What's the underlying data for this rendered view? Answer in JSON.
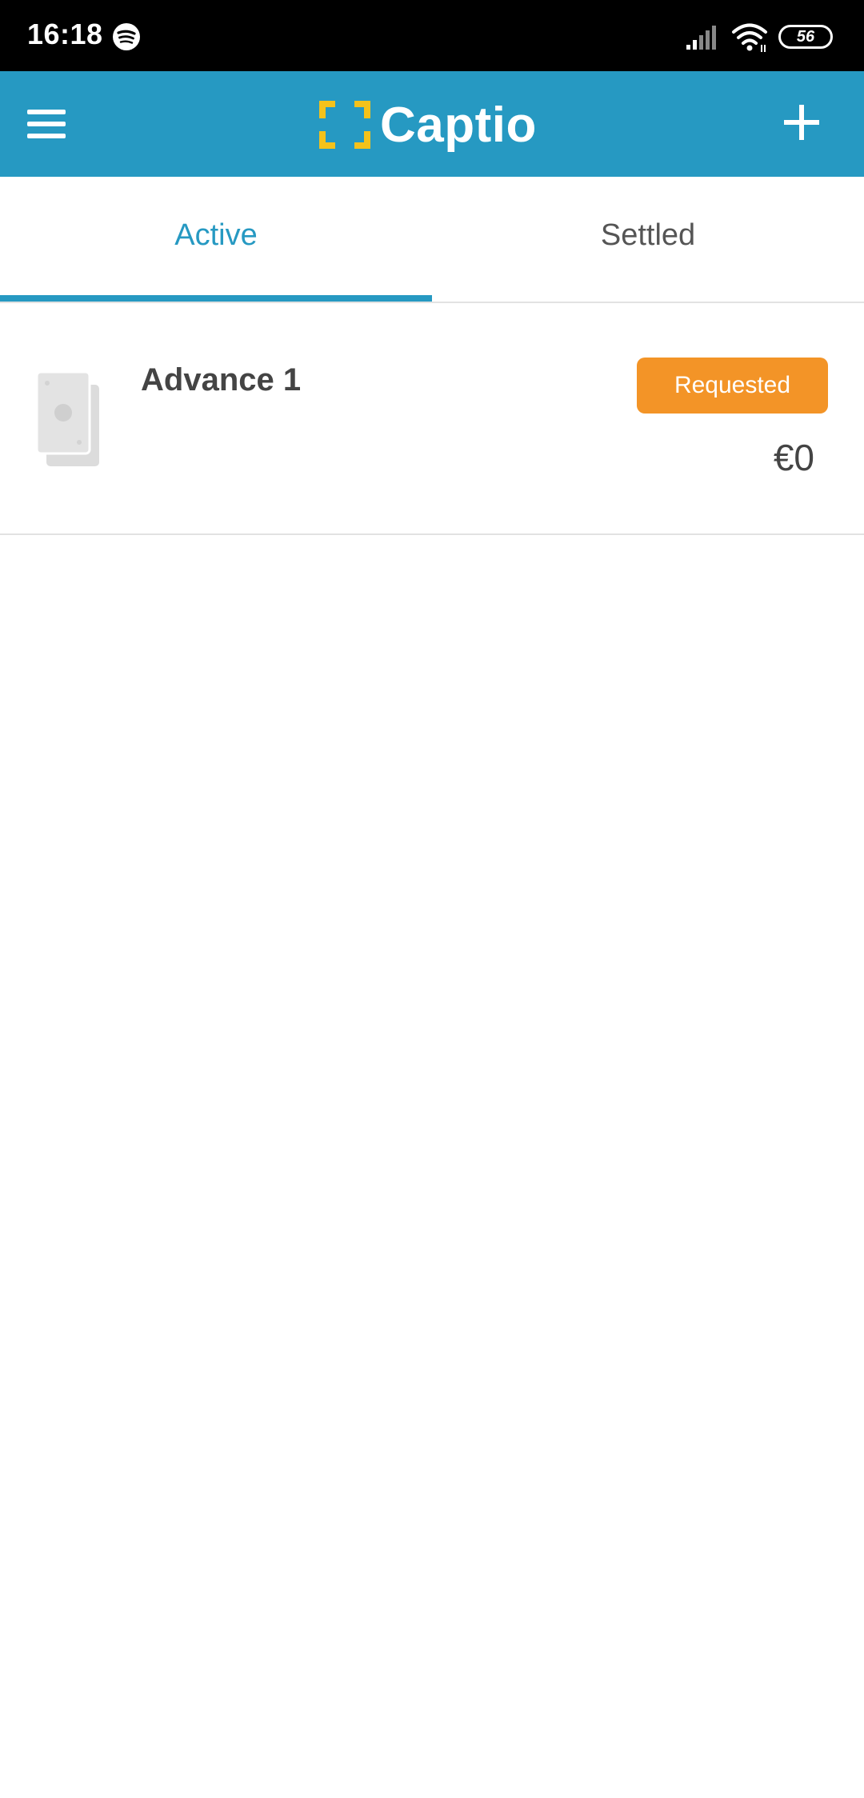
{
  "status_bar": {
    "time": "16:18",
    "battery": "56",
    "icons": [
      "spotify-icon",
      "signal-icon",
      "wifi-icon",
      "battery-icon"
    ]
  },
  "header": {
    "app_name": "Captio",
    "menu_icon": "hamburger-menu-icon",
    "add_icon": "plus-icon",
    "background_color": "#2699c2",
    "logo_color": "#f4c21b"
  },
  "tabs": [
    {
      "label": "Active",
      "selected": true
    },
    {
      "label": "Settled",
      "selected": false
    }
  ],
  "advances": [
    {
      "title": "Advance 1",
      "status": "Requested",
      "amount": "€0",
      "icon": "money-bills-icon",
      "status_color": "#f39427"
    }
  ]
}
